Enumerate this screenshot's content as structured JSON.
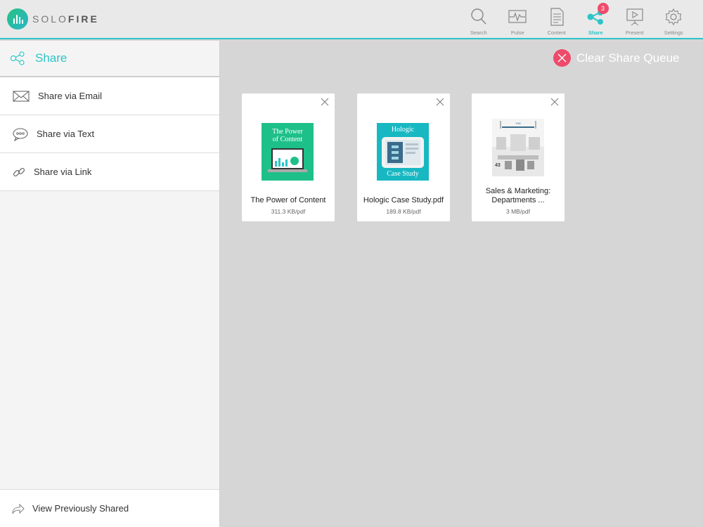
{
  "app": {
    "logo_text_light": "SOLO",
    "logo_text_bold": "FIRE",
    "accent_color": "#2cc4c8",
    "alert_color": "#ee4b6a"
  },
  "nav": [
    {
      "label": "Search",
      "icon": "search-icon"
    },
    {
      "label": "Pulse",
      "icon": "pulse-icon"
    },
    {
      "label": "Content",
      "icon": "document-icon"
    },
    {
      "label": "Share",
      "icon": "share-icon",
      "badge": "3",
      "active": true
    },
    {
      "label": "Present",
      "icon": "present-icon"
    },
    {
      "label": "Settings",
      "icon": "gear-icon"
    }
  ],
  "sidebar": {
    "title": "Share",
    "items": [
      {
        "label": "Share via Email",
        "icon": "envelope-icon"
      },
      {
        "label": "Share via Text",
        "icon": "chat-bubble-icon"
      },
      {
        "label": "Share via Link",
        "icon": "link-icon"
      }
    ],
    "footer_label": "View Previously Shared"
  },
  "main": {
    "clear_label": "Clear Share Queue",
    "cards": [
      {
        "name": "The Power of Content",
        "meta": "311.3 KB/pdf",
        "thumb_line1": "The Power",
        "thumb_line2": "of Content"
      },
      {
        "name": "Hologic Case Study.pdf",
        "meta": "189.8 KB/pdf",
        "thumb_line1": "Hologic",
        "thumb_line2": "Case Study"
      },
      {
        "name": "Sales & Marketing: Departments ...",
        "meta": "3 MB/pdf"
      }
    ]
  }
}
